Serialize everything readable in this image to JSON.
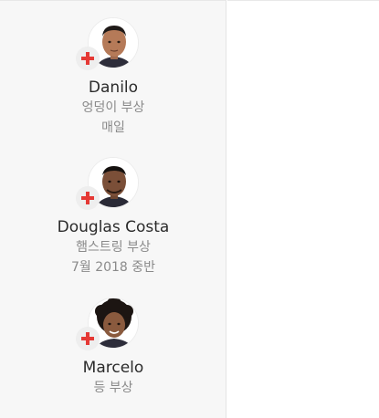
{
  "players": [
    {
      "name": "Danilo",
      "injury": "엉덩이 부상",
      "expected_return": "매일",
      "status_icon": "red-cross-icon"
    },
    {
      "name": "Douglas Costa",
      "injury": "햄스트링 부상",
      "expected_return": "7월 2018 중반",
      "status_icon": "red-cross-icon"
    },
    {
      "name": "Marcelo",
      "injury": "등 부상",
      "expected_return": "",
      "status_icon": "red-cross-icon"
    }
  ],
  "colors": {
    "injury_red": "#e53935",
    "panel_bg": "#f7f7f7"
  }
}
